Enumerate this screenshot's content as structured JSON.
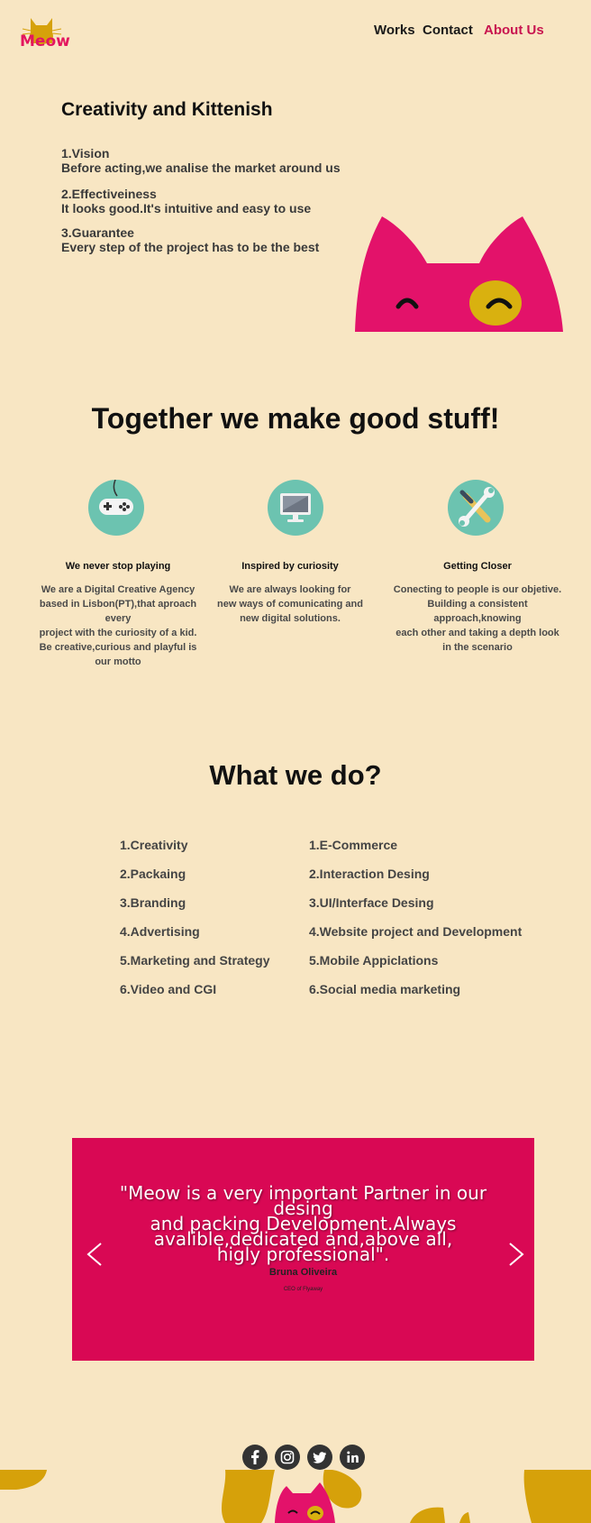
{
  "brand": {
    "logo_text": "Meow",
    "logo_icon": "cat-logo-icon"
  },
  "nav": {
    "items": [
      {
        "label": "Works"
      },
      {
        "label": "Contact"
      },
      {
        "label": "About Us"
      }
    ],
    "active": "About Us"
  },
  "intro": {
    "title": "Creativity and Kittenish",
    "items": [
      {
        "heading": "1.Vision",
        "text": "Before acting,we analise the market around us"
      },
      {
        "heading": "2.Effectiveiness",
        "text": "It looks good.It's intuitive and easy to use"
      },
      {
        "heading": "3.Guarantee",
        "text": "Every step of the project has to be the best"
      }
    ]
  },
  "together": {
    "title": "Together we make good stuff!",
    "features": [
      {
        "icon": "gamepad-icon",
        "title": "We never stop playing",
        "lines": [
          "We are a Digital Creative Agency",
          "based in Lisbon(PT),that aproach every",
          "project with the curiosity of a kid.",
          "Be creative,curious and playful is",
          "our motto"
        ]
      },
      {
        "icon": "monitor-icon",
        "title": "Inspired by curiosity",
        "lines": [
          "We are always looking for",
          "new ways of comunicating and",
          "new digital solutions."
        ]
      },
      {
        "icon": "tools-icon",
        "title": "Getting Closer",
        "lines": [
          "Conecting to people is our objetive.",
          "Building a consistent approach,knowing",
          "each other and taking a depth look",
          "in the scenario"
        ]
      }
    ]
  },
  "services": {
    "title": "What we do?",
    "left": [
      "1.Creativity",
      "2.Packaing",
      "3.Branding",
      "4.Advertising",
      "5.Marketing and Strategy",
      "6.Video and CGI"
    ],
    "right": [
      "1.E-Commerce",
      "2.Interaction Desing",
      "3.UI/Interface Desing",
      "4.Website project and Development",
      "5.Mobile Appiclations",
      "6.Social media marketing"
    ]
  },
  "testimonial": {
    "quote_lines": [
      "\"Meow is a very important Partner in our desing",
      "and packing Development.Always",
      "avalible,dedicated and,above all,",
      "higly professional\"."
    ],
    "author": "Bruna Oliveira",
    "role": "CEO of Flyaway"
  },
  "social": [
    "facebook-icon",
    "instagram-icon",
    "twitter-icon",
    "linkedin-icon"
  ],
  "colors": {
    "background": "#f8e6c3",
    "accent": "#d90854",
    "cat_pink": "#e3165f",
    "cat_yellow": "#d6a10a",
    "icon_teal": "#6cc3b0"
  }
}
